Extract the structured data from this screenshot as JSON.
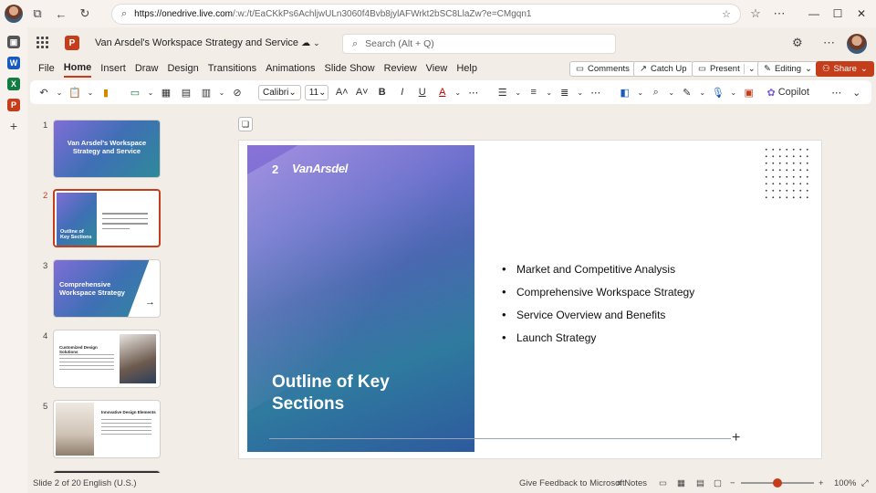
{
  "browser": {
    "url_host": "https://onedrive.live.com",
    "url_path": "/:w:/t/EaCKkPs6AchljwULn3060f4Bvb8jylAFWrkt2bSC8LlaZw?e=CMgqn1"
  },
  "app": {
    "doc_title": "Van Arsdel's Workspace Strategy and Service",
    "search_placeholder": "Search (Alt + Q)",
    "logo_letter": "P"
  },
  "menu": {
    "tabs": [
      "File",
      "Home",
      "Insert",
      "Draw",
      "Design",
      "Transitions",
      "Animations",
      "Slide Show",
      "Review",
      "View",
      "Help"
    ],
    "active": "Home",
    "comments": "Comments",
    "catch_up": "Catch Up",
    "present": "Present",
    "editing": "Editing",
    "share": "Share"
  },
  "ribbon": {
    "font_name": "Calibri",
    "font_size": "11",
    "copilot": "Copilot"
  },
  "thumbnails": [
    {
      "num": "1",
      "title": "Van Arsdel's Workspace Strategy and Service"
    },
    {
      "num": "2",
      "title": "Outline of Key Sections"
    },
    {
      "num": "3",
      "title": "Comprehensive Workspace Strategy"
    },
    {
      "num": "4",
      "title": "Customized Design Solutions"
    },
    {
      "num": "5",
      "title": "Innovative Design Elements"
    }
  ],
  "slide": {
    "number": "2",
    "brand": "VanArsdel",
    "title": "Outline of Key Sections",
    "bullets": [
      "Market and Competitive Analysis",
      "Comprehensive Workspace Strategy",
      "Service Overview and Benefits",
      "Launch Strategy"
    ]
  },
  "status": {
    "slide_info": "Slide 2 of 20",
    "language": "English (U.S.)",
    "feedback": "Give Feedback to Microsoft",
    "notes": "Notes",
    "zoom": "100%"
  },
  "colors": {
    "accent": "#c43e1c",
    "panel_start": "#8a72d9",
    "panel_end": "#2d5a9e"
  }
}
